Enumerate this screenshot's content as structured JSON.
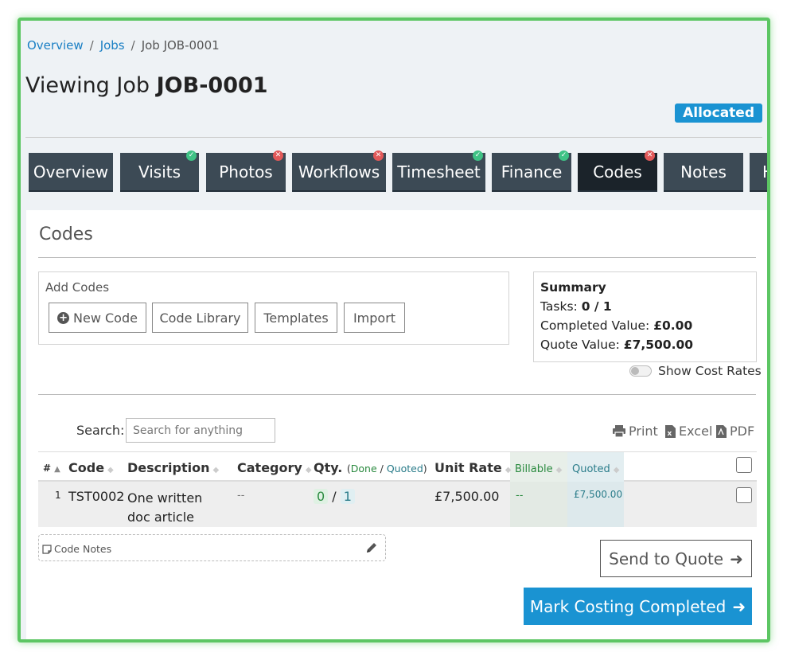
{
  "breadcrumb": {
    "item1": "Overview",
    "item2": "Jobs",
    "item3": "Job JOB-0001",
    "separator": "/"
  },
  "page": {
    "title_prefix": "Viewing Job ",
    "job_id": "JOB-0001",
    "status": "Allocated",
    "status_color": "#1a93d2"
  },
  "tabs": [
    {
      "label": "Overview",
      "status": "none"
    },
    {
      "label": "Visits",
      "status": "ok"
    },
    {
      "label": "Photos",
      "status": "error"
    },
    {
      "label": "Workflows",
      "status": "error"
    },
    {
      "label": "Timesheet",
      "status": "ok"
    },
    {
      "label": "Finance",
      "status": "ok"
    },
    {
      "label": "Codes",
      "status": "error",
      "active": true
    },
    {
      "label": "Notes",
      "status": "none"
    },
    {
      "label": "H",
      "status": "none"
    }
  ],
  "codes": {
    "section_title": "Codes",
    "add_codes_label": "Add Codes",
    "buttons": {
      "new_code": "New Code",
      "code_library": "Code Library",
      "templates": "Templates",
      "import": "Import"
    },
    "summary": {
      "title": "Summary",
      "tasks_label": "Tasks:",
      "tasks_value": "0 / 1",
      "completed_label": "Completed Value:",
      "completed_value": "£0.00",
      "quote_label": "Quote Value:",
      "quote_value": "£7,500.00"
    },
    "show_cost_rates": "Show Cost Rates",
    "show_cost_rates_on": false,
    "search": {
      "label": "Search:",
      "placeholder": "Search for anything"
    },
    "export": {
      "print": "Print",
      "excel": "Excel",
      "pdf": "PDF"
    },
    "table": {
      "headers": {
        "num": "#",
        "code": "Code",
        "description": "Description",
        "category": "Category",
        "qty": "Qty.",
        "qty_done": "Done",
        "qty_quoted": "Quoted",
        "unit_rate": "Unit Rate",
        "billable": "Billable",
        "quoted": "Quoted"
      },
      "rows": [
        {
          "num": "1",
          "code": "TST0002",
          "description_line1": "One written",
          "description_line2": "doc article",
          "category": "--",
          "qty_done": "0",
          "qty_quoted": "1",
          "unit_rate": "£7,500.00",
          "billable": "--",
          "quoted": "£7,500.00"
        }
      ]
    },
    "code_notes": "Code Notes",
    "send_to_quote": "Send to Quote",
    "mark_costing_completed": "Mark Costing Completed",
    "accent_color": "#1a93d2"
  }
}
